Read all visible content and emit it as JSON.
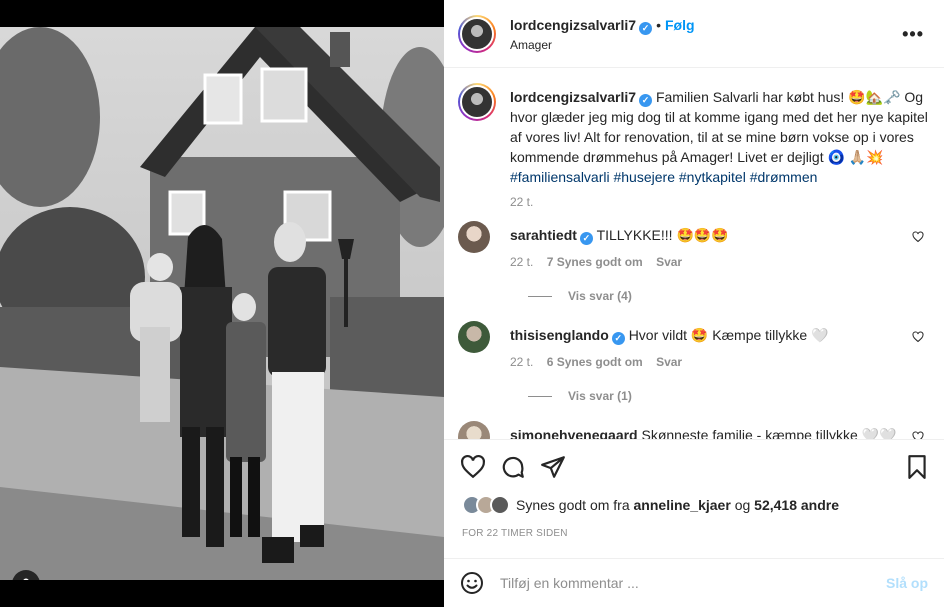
{
  "post": {
    "username": "lordcengizsalvarli7",
    "follow_label": "Følg",
    "separator": "•",
    "location": "Amager",
    "more_label": "•••"
  },
  "caption": {
    "username": "lordcengizsalvarli7",
    "text_1": "Familien Salvarli har købt hus! 🤩🏡🗝️ Og hvor glæder jeg mig dog til at komme igang med det her nye kapitel af vores liv! Alt for renovation, til at se mine børn vokse op i vores kommende drømmehus på Amager! Livet er dejligt 🧿 🙏🏼💥",
    "hashtags": [
      "#familiensalvarli",
      "#husejere",
      "#nytkapitel",
      "#drømmen"
    ],
    "time": "22 t."
  },
  "comments": [
    {
      "username": "sarahtiedt",
      "text": "TILLYKKE!!! 🤩🤩🤩",
      "time": "22 t.",
      "likes": "7 Synes godt om",
      "reply_label": "Svar",
      "view_replies": "Vis svar (4)"
    },
    {
      "username": "thisisenglando",
      "text": "Hvor vildt 🤩 Kæmpe tillykke 🤍",
      "time": "22 t.",
      "likes": "6 Synes godt om",
      "reply_label": "Svar",
      "view_replies": "Vis svar (1)"
    },
    {
      "username": "simonehvenegaard",
      "text": "Skønneste familie - kæmpe tillykke 🤍🤍🤍"
    }
  ],
  "likes": {
    "prefix": "Synes godt om fra",
    "first_user": "anneline_kjaer",
    "joiner": "og",
    "count": "52,418 andre",
    "posted": "FOR 22 TIMER SIDEN"
  },
  "add_comment": {
    "placeholder": "Tilføj en kommentar ...",
    "post_label": "Slå op"
  },
  "icons": {
    "like": "heart-icon",
    "comment": "comment-icon",
    "share": "send-icon",
    "save": "bookmark-icon",
    "emoji": "emoji-icon",
    "tag": "user-tag-icon"
  },
  "colors": {
    "accent": "#0095f6",
    "verified": "#3897f0",
    "hashtag": "#00376b",
    "muted": "#8e8e8e"
  }
}
